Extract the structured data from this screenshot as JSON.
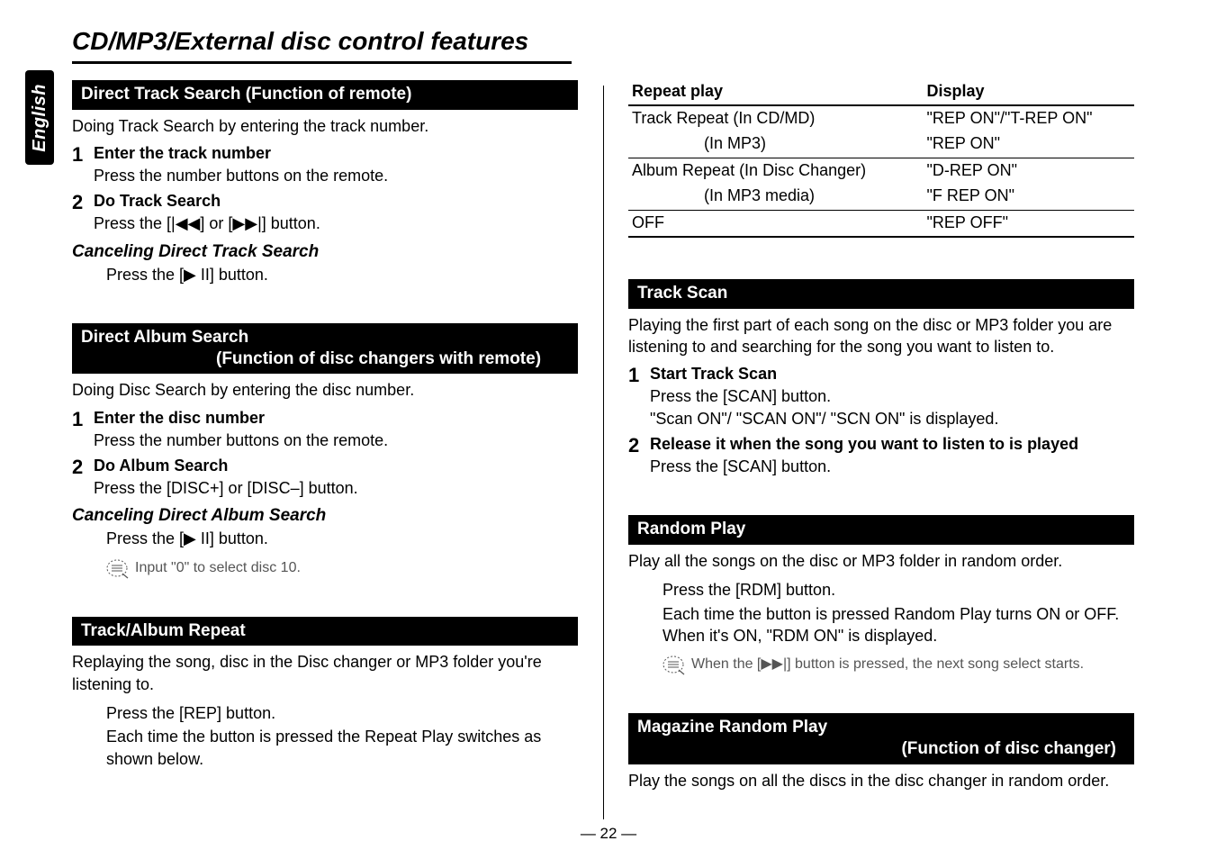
{
  "sideTab": "English",
  "pageTitle": "CD/MP3/External disc control features",
  "s1": {
    "header": "Direct Track Search (Function of remote)",
    "desc": "Doing Track Search by entering the track number.",
    "step1t": "Enter the track number",
    "step1x": "Press the number buttons on the remote.",
    "step2t": "Do Track Search",
    "step2x": "Press the [|◀◀] or [▶▶|] button.",
    "cancelH": "Canceling Direct Track Search",
    "cancelX": "Press the [▶ II] button."
  },
  "s2": {
    "headerA": "Direct Album Search",
    "headerB": "(Function of disc changers with remote)",
    "desc": "Doing Disc Search by entering the disc number.",
    "step1t": "Enter the disc number",
    "step1x": "Press the number buttons on the remote.",
    "step2t": "Do Album Search",
    "step2x": "Press the [DISC+] or [DISC–] button.",
    "cancelH": "Canceling Direct Album Search",
    "cancelX": "Press the [▶ II] button.",
    "note": "Input \"0\" to select disc 10."
  },
  "s3": {
    "header": "Track/Album Repeat",
    "desc": "Replaying the song, disc in the Disc changer or MP3 folder you're listening to.",
    "press": "Press the [REP] button.",
    "pressX": "Each time the button is pressed the Repeat Play switches as shown below."
  },
  "table": {
    "h1": "Repeat play",
    "h2": "Display",
    "r1a": "Track Repeat (In CD/MD)",
    "r1b": "\"REP ON\"/\"T-REP ON\"",
    "r1c": "(In MP3)",
    "r1d": "\"REP ON\"",
    "r2a": "Album Repeat (In Disc Changer)",
    "r2b": "\"D-REP ON\"",
    "r2c": "(In MP3 media)",
    "r2d": "\"F REP ON\"",
    "r3a": "OFF",
    "r3b": "\"REP OFF\""
  },
  "s4": {
    "header": "Track Scan",
    "desc": "Playing the first part of each song on the disc or MP3 folder you are listening to and searching for the song you want to listen to.",
    "step1t": "Start Track Scan",
    "step1x1": "Press the [SCAN] button.",
    "step1x2": "\"Scan ON\"/ \"SCAN ON\"/ \"SCN ON\" is displayed.",
    "step2t": "Release it when the song you want to listen to is played",
    "step2x": "Press the [SCAN] button."
  },
  "s5": {
    "header": "Random Play",
    "desc": "Play all the songs on the disc or MP3 folder in random order.",
    "press": "Press the [RDM] button.",
    "pressX": "Each time the button is pressed Random Play turns ON or OFF. When it's ON, \"RDM ON\" is displayed.",
    "note": "When the [▶▶|] button is pressed, the next song select starts."
  },
  "s6": {
    "headerA": "Magazine Random Play",
    "headerB": "(Function of disc changer)",
    "desc": "Play the songs on all the discs in the disc changer in random order."
  },
  "footer": "— 22 —"
}
